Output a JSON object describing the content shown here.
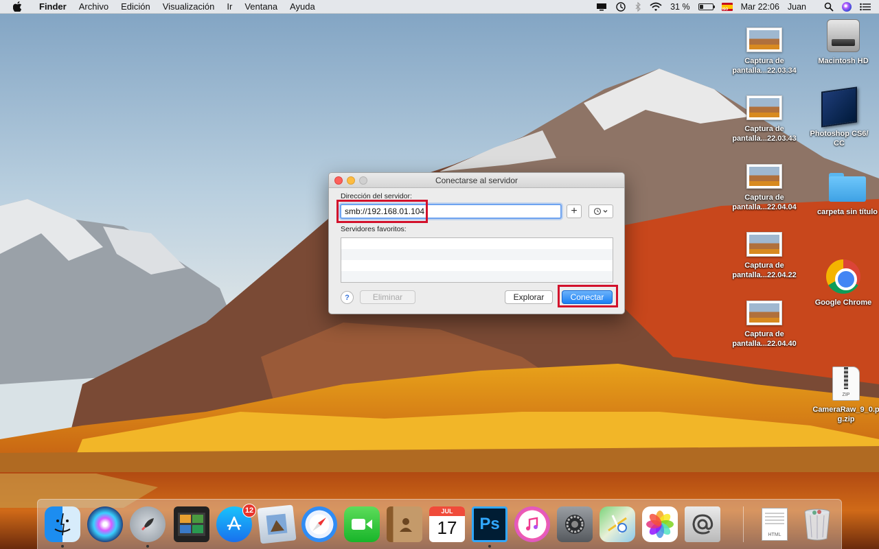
{
  "menubar": {
    "app_name": "Finder",
    "menus": [
      "Archivo",
      "Edición",
      "Visualización",
      "Ir",
      "Ventana",
      "Ayuda"
    ],
    "battery_percent": "31 %",
    "battery_level": 0.31,
    "clock": "Mar 22:06",
    "user": "Juan",
    "icons": [
      "apple-icon",
      "display-icon",
      "time-machine-icon",
      "bluetooth-icon",
      "wifi-icon",
      "battery-icon",
      "spain-flag-icon",
      "spotlight-icon",
      "siri-icon",
      "notification-center-icon"
    ]
  },
  "desktop": {
    "icons": [
      {
        "label": "Captura de pantalla...22.03.34",
        "kind": "screenshot-icon"
      },
      {
        "label": "Captura de pantalla...22.03.43",
        "kind": "screenshot-icon"
      },
      {
        "label": "Captura de pantalla...22.04.04",
        "kind": "screenshot-icon"
      },
      {
        "label": "Captura de pantalla...22.04.22",
        "kind": "screenshot-icon"
      },
      {
        "label": "Captura de pantalla...22.04.40",
        "kind": "screenshot-icon"
      },
      {
        "label": "Macintosh HD",
        "kind": "hard-drive-icon"
      },
      {
        "label": "Photoshop CS6/ CC",
        "kind": "photoshop-box-icon"
      },
      {
        "label": "carpeta sin título",
        "kind": "folder-icon"
      },
      {
        "label": "Google Chrome",
        "kind": "chrome-icon"
      },
      {
        "label": "CameraRaw_9_0.p g.zip",
        "kind": "zip-file-icon"
      }
    ]
  },
  "dialog": {
    "title": "Conectarse al servidor",
    "address_label": "Dirección del servidor:",
    "address_value": "smb://192.168.01.104",
    "add_label": "+",
    "favorites_label": "Servidores favoritos:",
    "help_label": "?",
    "remove_label": "Eliminar",
    "browse_label": "Explorar",
    "connect_label": "Conectar"
  },
  "dock": {
    "apps": [
      "Finder",
      "Siri",
      "Launchpad",
      "Mission Control",
      "App Store",
      "Preview",
      "Safari",
      "FaceTime",
      "Contacts",
      "Calendar",
      "Photoshop",
      "iTunes",
      "System Preferences",
      "Maps",
      "Photos",
      "Mail"
    ],
    "app_store_badge": "12",
    "calendar_month": "JUL",
    "calendar_day": "17",
    "photoshop_label": "Ps",
    "document_label": "HTML"
  },
  "colors": {
    "highlight_red": "#d2102b",
    "accent_blue": "#1a7ff5"
  }
}
